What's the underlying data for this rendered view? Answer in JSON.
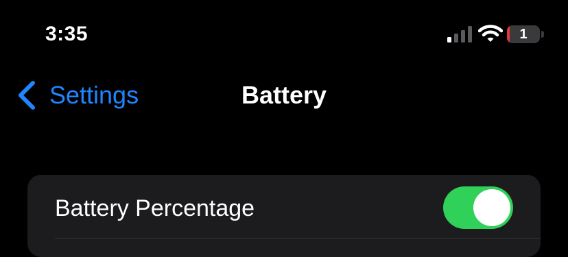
{
  "status_bar": {
    "time": "3:35",
    "battery_level": "1",
    "battery_fill_fraction": 0.08,
    "battery_color": "#e5383b",
    "signal_icon": "cellular-signal-icon",
    "wifi_icon": "wifi-icon"
  },
  "nav": {
    "back_label": "Settings",
    "back_icon": "chevron-left-icon",
    "title": "Battery",
    "accent_color": "#1f86ff"
  },
  "settings": {
    "battery_percentage": {
      "label": "Battery Percentage",
      "enabled": true,
      "toggle_color": "#30d158"
    }
  }
}
